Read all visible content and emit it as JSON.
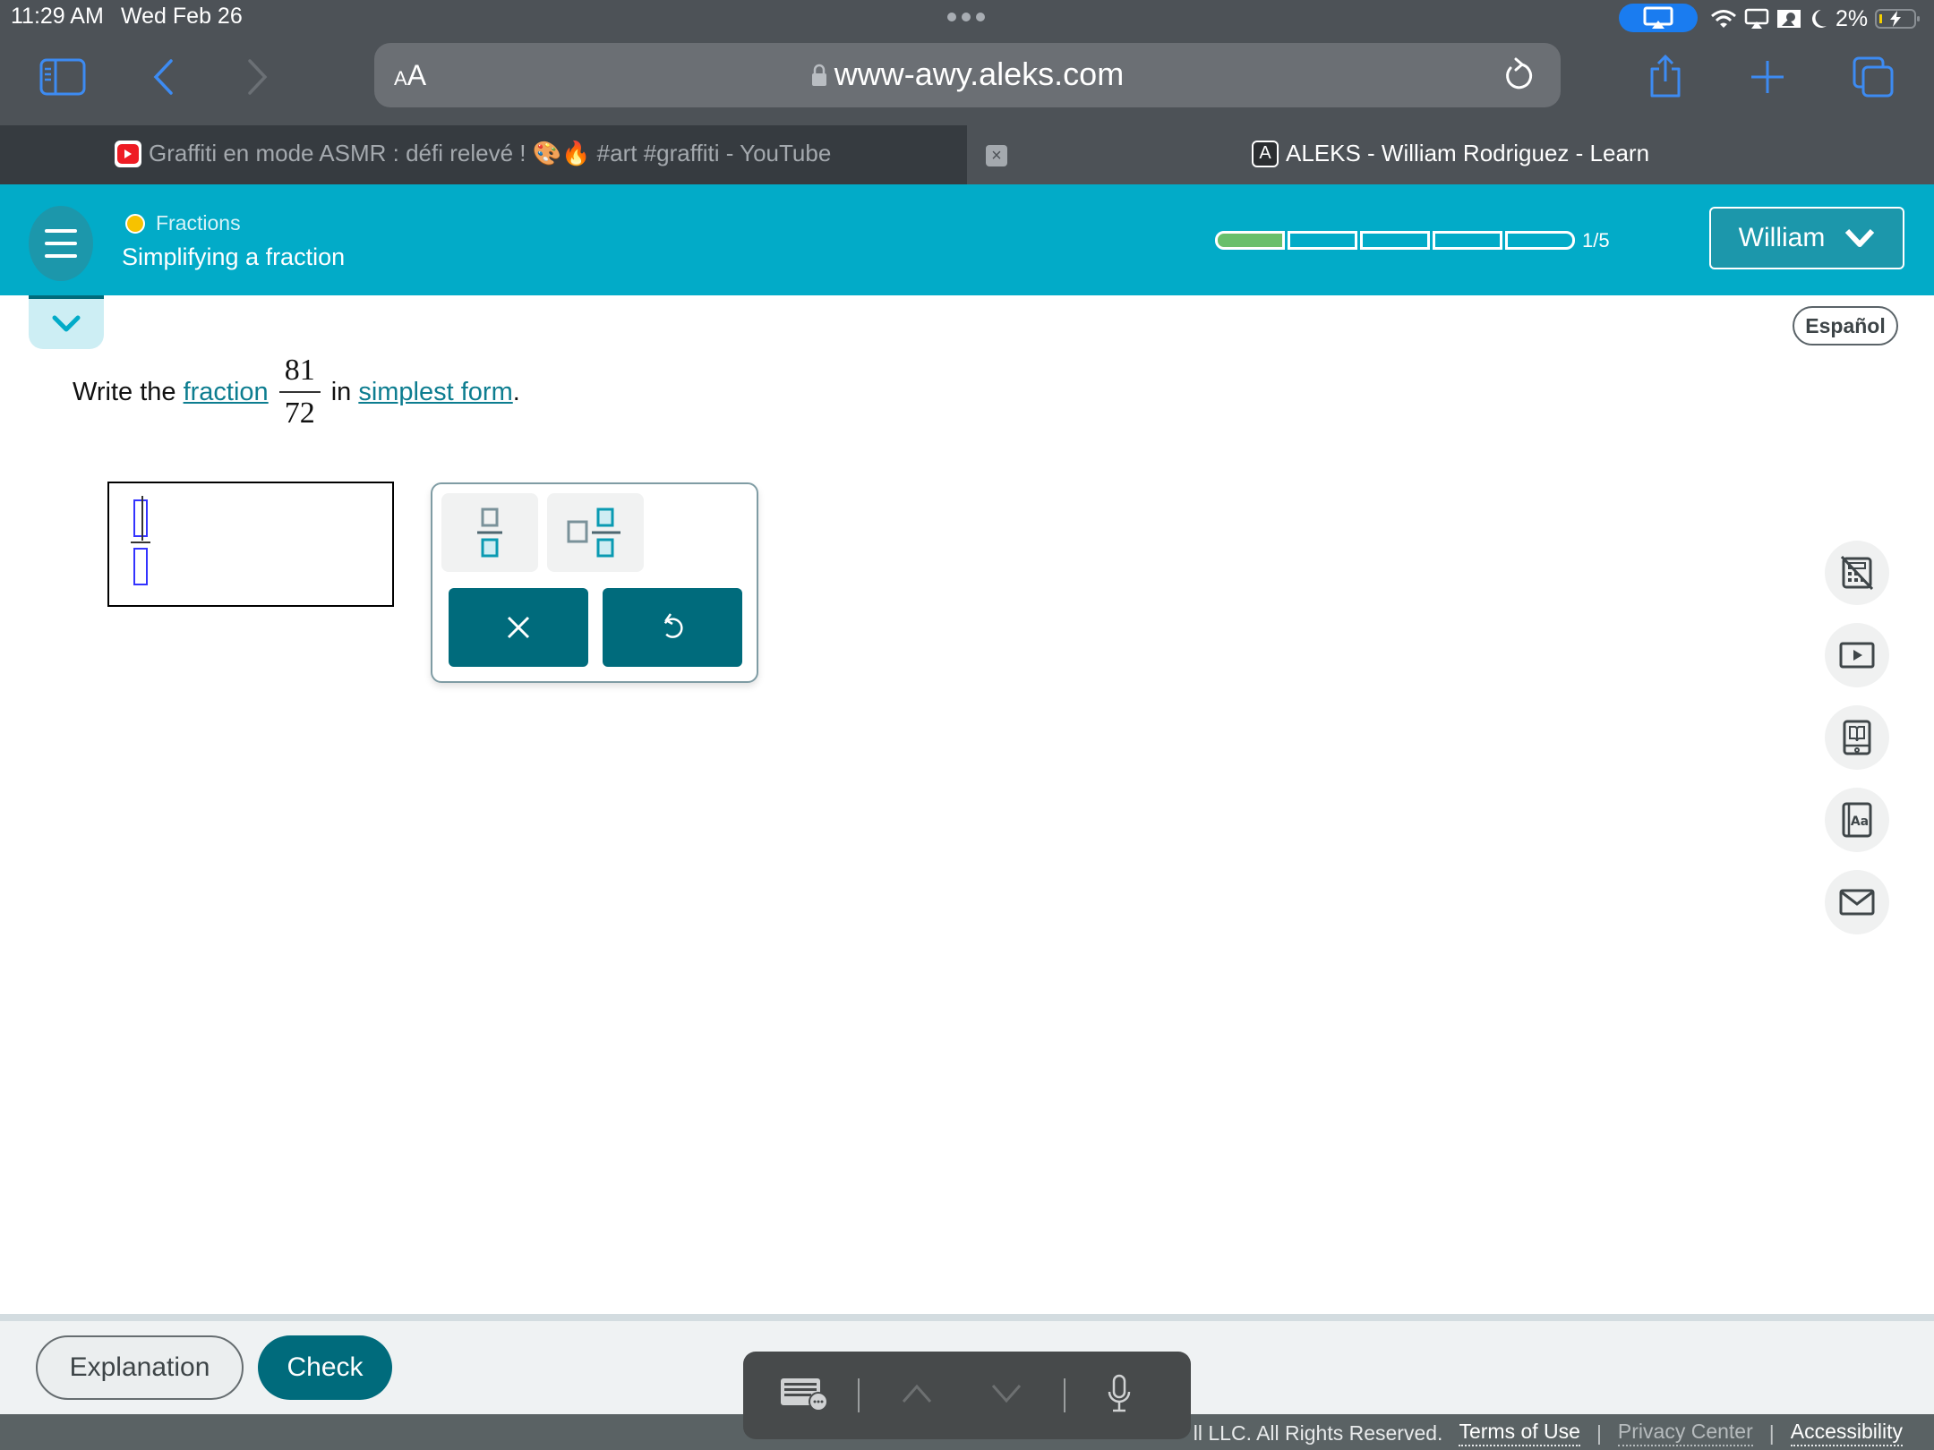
{
  "status_bar": {
    "time": "11:29 AM",
    "date": "Wed Feb 26",
    "battery": "2%",
    "icons": [
      "screen-mirroring-icon",
      "wifi-icon",
      "airplay-icon",
      "screen-record-icon",
      "do-not-disturb-moon-icon",
      "battery-charging-icon"
    ]
  },
  "browser": {
    "text_size_label": "AA",
    "url": "www-awy.aleks.com",
    "toolbar_icons": [
      "sidebar-icon",
      "back-icon",
      "forward-icon",
      "lock-icon",
      "reload-icon",
      "share-icon",
      "new-tab-icon",
      "tabs-icon"
    ],
    "tabs": [
      {
        "title": "Graffiti en mode ASMR : défi relevé ! 🎨🔥 #art #graffiti - YouTube",
        "active": false,
        "favicon": "youtube-icon"
      },
      {
        "title": "ALEKS - William Rodriguez - Learn",
        "active": true,
        "favicon": "aleks-icon",
        "favicon_letter": "A"
      }
    ],
    "close_tab_label": "×"
  },
  "header": {
    "topic": "Fractions",
    "topic_status_color": "#f7c200",
    "lesson_title": "Simplifying a fraction",
    "progress": {
      "completed": 1,
      "total": 5,
      "label": "1/5"
    },
    "user_name": "William",
    "accent_color": "#02abc8"
  },
  "language_button": "Español",
  "problem": {
    "prefix": "Write the",
    "link1": "fraction",
    "numerator": "81",
    "denominator": "72",
    "middle": "in",
    "link2": "simplest form",
    "suffix": "."
  },
  "answer": {
    "numerator": "",
    "denominator": ""
  },
  "palette": {
    "keys": [
      "fraction-template",
      "mixed-number-template"
    ],
    "actions": [
      "clear",
      "undo"
    ],
    "clear_label": "×"
  },
  "tools": [
    "calculator-disabled-icon",
    "video-icon",
    "ebook-icon",
    "dictionary-icon",
    "message-icon"
  ],
  "footer_buttons": {
    "explanation": "Explanation",
    "check": "Check"
  },
  "footer": {
    "copyright": "ll LLC. All Rights Reserved.",
    "links": [
      "Terms of Use",
      "Privacy Center",
      "Accessibility"
    ],
    "separator": "|"
  },
  "keyboard_bar": [
    "keyboard-icon",
    "chevron-up-icon",
    "chevron-down-icon",
    "microphone-icon"
  ]
}
